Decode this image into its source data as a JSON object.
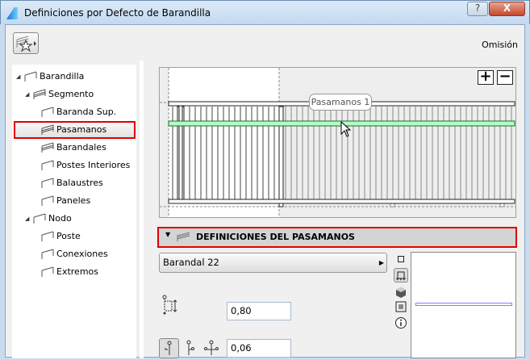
{
  "window": {
    "title": "Definiciones por Defecto de Barandilla",
    "help_label": "?",
    "close_label": "X"
  },
  "toolbar": {
    "favorites_icon": "railing-star-icon",
    "omision": "Omisión"
  },
  "tree": [
    {
      "label": "Barandilla",
      "level": 0,
      "expanded": true
    },
    {
      "label": "Segmento",
      "level": 1,
      "expanded": true
    },
    {
      "label": "Baranda Sup.",
      "level": 2
    },
    {
      "label": "Pasamanos",
      "level": 2,
      "selected": true
    },
    {
      "label": "Barandales",
      "level": 2
    },
    {
      "label": "Postes Interiores",
      "level": 2
    },
    {
      "label": "Balaustres",
      "level": 2
    },
    {
      "label": "Paneles",
      "level": 2
    },
    {
      "label": "Nodo",
      "level": 1,
      "expanded": true
    },
    {
      "label": "Poste",
      "level": 2
    },
    {
      "label": "Conexiones",
      "level": 2
    },
    {
      "label": "Extremos",
      "level": 2
    }
  ],
  "preview": {
    "zoom_in": "+",
    "zoom_out": "−",
    "tooltip": "Pasamanos 1",
    "highlight_color": "#b3ffc6"
  },
  "section": {
    "title": "DEFINICIONES DEL PASAMANOS"
  },
  "profile": {
    "selected": "Barandal 22"
  },
  "fields": {
    "height": "0,80",
    "offset": "0,06"
  }
}
